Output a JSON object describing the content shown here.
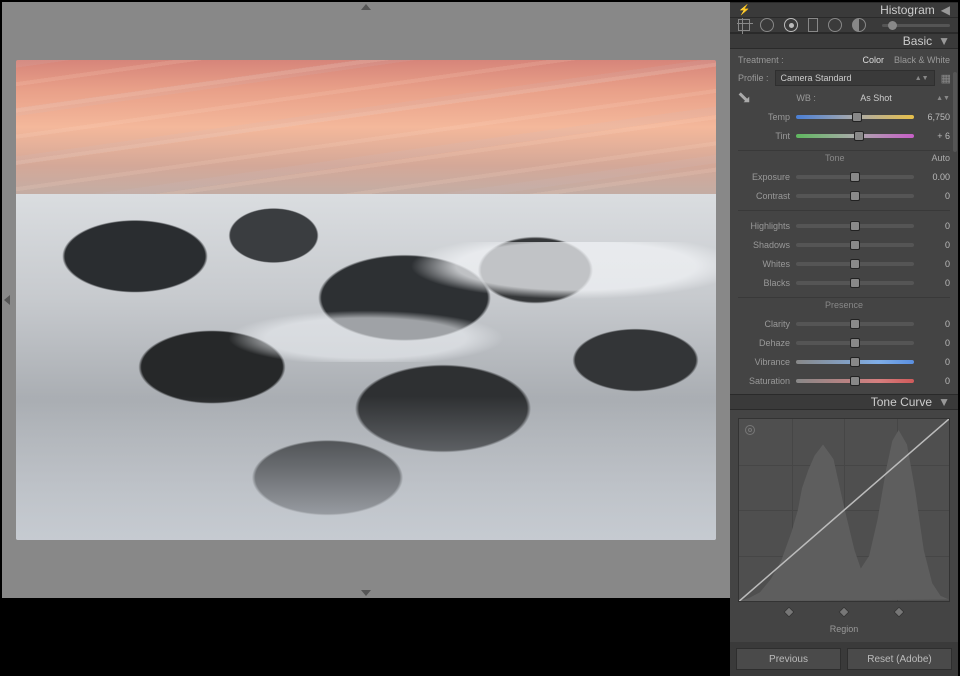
{
  "panels": {
    "histogram": "Histogram",
    "basic": "Basic",
    "toneCurve": "Tone Curve"
  },
  "treatment": {
    "label": "Treatment :",
    "color": "Color",
    "bw": "Black & White"
  },
  "profile": {
    "label": "Profile :",
    "value": "Camera Standard"
  },
  "wb": {
    "label": "WB :",
    "preset": "As Shot"
  },
  "sliders": {
    "temp": {
      "label": "Temp",
      "value": "6,750",
      "pos": 52
    },
    "tint": {
      "label": "Tint",
      "value": "+ 6",
      "pos": 53
    },
    "exposure": {
      "label": "Exposure",
      "value": "0.00",
      "pos": 50
    },
    "contrast": {
      "label": "Contrast",
      "value": "0",
      "pos": 50
    },
    "highlights": {
      "label": "Highlights",
      "value": "0",
      "pos": 50
    },
    "shadows": {
      "label": "Shadows",
      "value": "0",
      "pos": 50
    },
    "whites": {
      "label": "Whites",
      "value": "0",
      "pos": 50
    },
    "blacks": {
      "label": "Blacks",
      "value": "0",
      "pos": 50
    },
    "clarity": {
      "label": "Clarity",
      "value": "0",
      "pos": 50
    },
    "dehaze": {
      "label": "Dehaze",
      "value": "0",
      "pos": 50
    },
    "vibrance": {
      "label": "Vibrance",
      "value": "0",
      "pos": 50
    },
    "saturation": {
      "label": "Saturation",
      "value": "0",
      "pos": 50
    }
  },
  "groups": {
    "tone": "Tone",
    "auto": "Auto",
    "presence": "Presence"
  },
  "toneCurve": {
    "region": "Region"
  },
  "buttons": {
    "previous": "Previous",
    "reset": "Reset (Adobe)"
  }
}
